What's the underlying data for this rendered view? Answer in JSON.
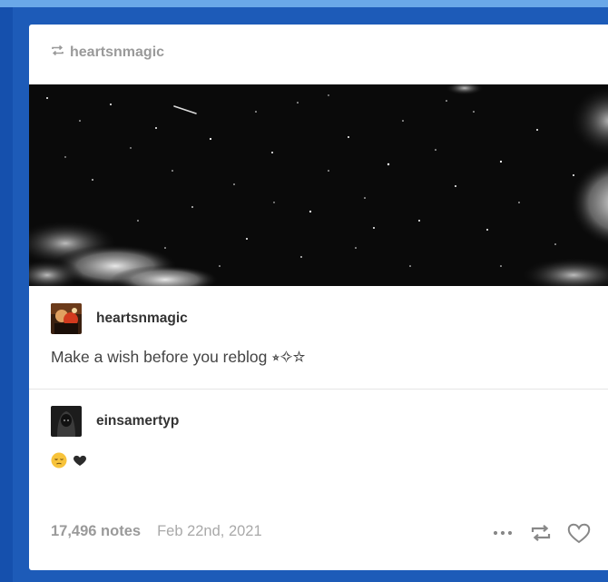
{
  "reblog_header": {
    "username": "heartsnmagic",
    "icon": "reblog-icon"
  },
  "post_image": {
    "description_icon": "night-sky-photo"
  },
  "original_post": {
    "username": "heartsnmagic",
    "text": "Make a wish before you reblog ⭒✧☆"
  },
  "reply": {
    "username": "einsamertyp",
    "emoji": [
      "pensive-face-emoji",
      "black-heart-emoji"
    ]
  },
  "footer": {
    "notes": "17,496 notes",
    "date": "Feb 22nd, 2021",
    "actions": [
      "more-icon",
      "reblog-icon",
      "heart-icon"
    ]
  },
  "colors": {
    "background": "#1d5bb8",
    "card": "#ffffff",
    "muted_text": "#9a9a9a"
  }
}
